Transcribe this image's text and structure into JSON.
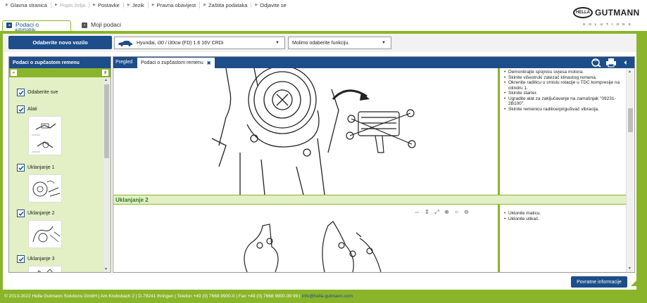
{
  "topnav": {
    "items": [
      {
        "label": "Glavna stranica",
        "disabled": false
      },
      {
        "label": "Popis želja",
        "disabled": true
      },
      {
        "label": "Postavke",
        "disabled": false
      },
      {
        "label": "Jezik",
        "disabled": false
      },
      {
        "label": "Pravna obavijest",
        "disabled": false
      },
      {
        "label": "Zaštita podataka",
        "disabled": false
      },
      {
        "label": "Odjavite se",
        "disabled": false
      }
    ]
  },
  "logo": {
    "mark": "HELLA",
    "brand": "GUTMANN",
    "tagline": "SOLUTIONS"
  },
  "tabs": {
    "tab1_label": "Podaci o",
    "tab1_sub": "automobilu",
    "tab2_label": "Moji podaci"
  },
  "vehicle_bar": {
    "new_vehicle_button": "Odaberite novo vozilo",
    "vehicle_value": "Hyundai, i30 / i30cw (FD) 1.6 16V CRDi",
    "function_placeholder": "Molimo odaberite funkciju."
  },
  "left_panel": {
    "title": "Podaci o zupčastom remenu",
    "items": [
      {
        "label": "Odaberite sve"
      },
      {
        "label": "Alati"
      },
      {
        "label": "Uklanjanje 1"
      },
      {
        "label": "Uklanjanje 2"
      },
      {
        "label": "Uklanjanje 3"
      }
    ]
  },
  "main_panel": {
    "tab_overview": "Pregled",
    "tab_active": "Podaci o zupčastom remenu",
    "section1_steps": [
      "Demontirajte spojnicu ovjesa motora.",
      "Skinite višestruki zatezač klinastog remena.",
      "Okrenite radilicu u smislu rotacije u TDC kompresije na cilindru 1.",
      "Skinite starter.",
      "Ugradite alat za zaključavanje na zamašnjak \"09231-2B100\".",
      "Skinite remenicu radilice/prigušivač vibracija."
    ],
    "section2_title": "Uklanjanje 2",
    "section2_steps": [
      "Uklonite maticu.",
      "Uklonite utikač."
    ]
  },
  "feedback_button": "Povratne informacije",
  "footer": {
    "text": "© 2013-2022 Hella Gutmann Solutions GmbH | Am Krebsbach 2 | D-79241 Ihringen | Telefon +49 (0) 7668 9900-0 | Fax +49 (0) 7668 9900-39 99 |",
    "email": "info@hella-gutmann.com"
  },
  "colors": {
    "brand_blue": "#1d4d8a",
    "brand_green": "#8ab52a",
    "pale_green": "#e3efc5"
  }
}
